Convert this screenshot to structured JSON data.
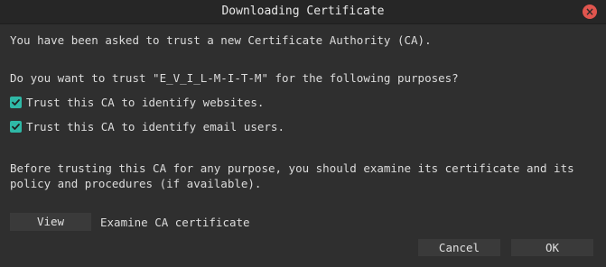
{
  "window": {
    "title": "Downloading Certificate",
    "close_glyph": "×"
  },
  "dialog": {
    "intro": "You have been asked to trust a new Certificate Authority (CA).",
    "question": "Do you want to trust \"E_V_I_L-M-I-T-M\" for the following purposes?",
    "options": [
      {
        "label": "Trust this CA to identify websites.",
        "checked": true
      },
      {
        "label": "Trust this CA to identify email users.",
        "checked": true
      }
    ],
    "advice": "Before trusting this CA for any purpose, you should examine its certificate and its policy and procedures (if available).",
    "view_label": "View",
    "view_description": "Examine CA certificate",
    "cancel_label": "Cancel",
    "ok_label": "OK"
  },
  "colors": {
    "background": "#2f2f2f",
    "checkbox_accent": "#2fb8a6",
    "close_button": "#e0554e"
  },
  "icons": {
    "close": "close-icon",
    "check": "checkmark-icon"
  }
}
